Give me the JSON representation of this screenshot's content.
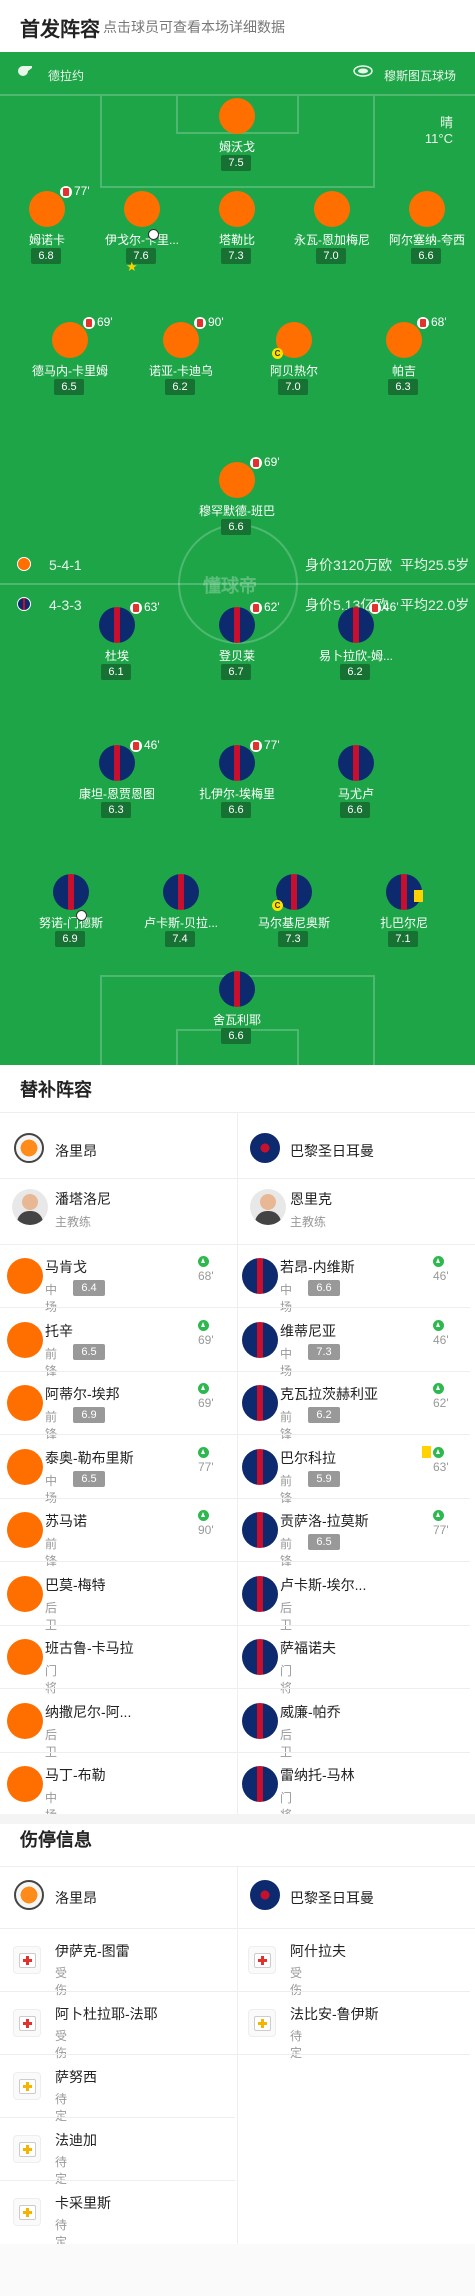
{
  "header": {
    "title": "首发阵容",
    "subtitle": "点击球员可查看本场详细数据"
  },
  "pitch": {
    "home_team": "德拉约",
    "away_team": "穆斯图瓦球场",
    "weather": "晴",
    "temperature": "11°C",
    "watermark": "懂球帝",
    "lorient_formation": "5-4-1",
    "lorient_value": "身价3120万欧",
    "lorient_age": "平均25.5岁",
    "psg_formation": "4-3-3",
    "psg_value": "身价5.13亿欧",
    "psg_age": "平均22.0岁",
    "lorient_players": [
      {
        "name": "姆沃戈",
        "rating": "7.5"
      },
      {
        "name": "姆诺卡",
        "rating": "6.8",
        "sub_time": "77'"
      },
      {
        "name": "伊戈尔-卡里...",
        "rating": "7.6"
      },
      {
        "name": "塔勒比",
        "rating": "7.3"
      },
      {
        "name": "永瓦-恩加梅尼",
        "rating": "7.0"
      },
      {
        "name": "阿尔塞纳-夸西",
        "rating": "6.6"
      },
      {
        "name": "德马内-卡里姆",
        "rating": "6.5",
        "sub_time": "69'"
      },
      {
        "name": "诺亚-卡迪乌",
        "rating": "6.2",
        "sub_time": "90'"
      },
      {
        "name": "阿贝热尔",
        "rating": "7.0",
        "captain": "C"
      },
      {
        "name": "帕吉",
        "rating": "6.3",
        "sub_time": "68'"
      },
      {
        "name": "穆罕默德-班巴",
        "rating": "6.6",
        "sub_time": "69'"
      }
    ],
    "psg_players": [
      {
        "name": "杜埃",
        "rating": "6.1",
        "sub_time": "63'"
      },
      {
        "name": "登贝莱",
        "rating": "6.7",
        "sub_time": "62'"
      },
      {
        "name": "易卜拉欣-姆...",
        "rating": "6.2",
        "sub_time": "46'"
      },
      {
        "name": "康坦-恩贾恩图",
        "rating": "6.3",
        "sub_time": "46'"
      },
      {
        "name": "扎伊尔-埃梅里",
        "rating": "6.6",
        "sub_time": "77'"
      },
      {
        "name": "马尤卢",
        "rating": "6.6"
      },
      {
        "name": "努诺-门德斯",
        "rating": "6.9"
      },
      {
        "name": "卢卡斯-贝拉...",
        "rating": "7.4"
      },
      {
        "name": "马尔基尼奥斯",
        "rating": "7.3",
        "captain": "C"
      },
      {
        "name": "扎巴尔尼",
        "rating": "7.1"
      },
      {
        "name": "舍瓦利耶",
        "rating": "6.6"
      }
    ]
  },
  "subs": {
    "title": "替补阵容",
    "home_team": "洛里昂",
    "away_team": "巴黎圣日耳曼",
    "home_coach": {
      "name": "潘塔洛尼",
      "role": "主教练"
    },
    "away_coach": {
      "name": "恩里克",
      "role": "主教练"
    },
    "home": [
      {
        "name": "马肯戈",
        "pos": "中场",
        "rating": "6.4",
        "sub_in": "68'"
      },
      {
        "name": "托辛",
        "pos": "前锋",
        "rating": "6.5",
        "sub_in": "69'"
      },
      {
        "name": "阿蒂尔-埃邦",
        "pos": "前锋",
        "rating": "6.9",
        "sub_in": "69'"
      },
      {
        "name": "泰奥-勒布里斯",
        "pos": "中场",
        "rating": "6.5",
        "sub_in": "77'"
      },
      {
        "name": "苏马诺",
        "pos": "前锋",
        "sub_in": "90'"
      },
      {
        "name": "巴莫-梅特",
        "pos": "后卫"
      },
      {
        "name": "班古鲁-卡马拉",
        "pos": "门将"
      },
      {
        "name": "纳撒尼尔-阿...",
        "pos": "后卫"
      },
      {
        "name": "马丁-布勒",
        "pos": "中场"
      }
    ],
    "away": [
      {
        "name": "若昂-内维斯",
        "pos": "中场",
        "rating": "6.6",
        "sub_in": "46'"
      },
      {
        "name": "维蒂尼亚",
        "pos": "中场",
        "rating": "7.3",
        "sub_in": "46'"
      },
      {
        "name": "克瓦拉茨赫利亚",
        "pos": "前锋",
        "rating": "6.2",
        "sub_in": "62'"
      },
      {
        "name": "巴尔科拉",
        "pos": "前锋",
        "rating": "5.9",
        "sub_in": "63'",
        "card": "yellow"
      },
      {
        "name": "贡萨洛-拉莫斯",
        "pos": "前锋",
        "rating": "6.5",
        "sub_in": "77'"
      },
      {
        "name": "卢卡斯-埃尔...",
        "pos": "后卫"
      },
      {
        "name": "萨福诺夫",
        "pos": "门将"
      },
      {
        "name": "威廉-帕乔",
        "pos": "后卫"
      },
      {
        "name": "雷纳托-马林",
        "pos": "门将"
      }
    ]
  },
  "injuries": {
    "title": "伤停信息",
    "home_team": "洛里昂",
    "away_team": "巴黎圣日耳曼",
    "home": [
      {
        "name": "伊萨克-图雷",
        "status": "受伤",
        "kind": "injury"
      },
      {
        "name": "阿卜杜拉耶-法耶",
        "status": "受伤",
        "kind": "injury"
      },
      {
        "name": "萨努西",
        "status": "待定",
        "kind": "doubt"
      },
      {
        "name": "法迪加",
        "status": "待定",
        "kind": "doubt"
      },
      {
        "name": "卡采里斯",
        "status": "待定",
        "kind": "doubt"
      }
    ],
    "away": [
      {
        "name": "阿什拉夫",
        "status": "受伤",
        "kind": "injury"
      },
      {
        "name": "法比安-鲁伊斯",
        "status": "待定",
        "kind": "doubt"
      }
    ]
  },
  "colors": {
    "pitch": "#1ea548",
    "lorient": "#ff6f00",
    "psg_navy": "#0e2a6e",
    "psg_red": "#c8102e",
    "sub_in": "#2fb84f",
    "injury": "#e0332d",
    "doubt": "#f5b400"
  },
  "icons": [
    "whistle-icon",
    "stadium-icon",
    "substitution-off-icon",
    "substitution-in-icon",
    "captain-icon",
    "goal-ball-icon",
    "yellow-card-icon",
    "star-icon",
    "injury-icon",
    "doubt-icon",
    "lorient-logo-icon",
    "psg-logo-icon"
  ]
}
